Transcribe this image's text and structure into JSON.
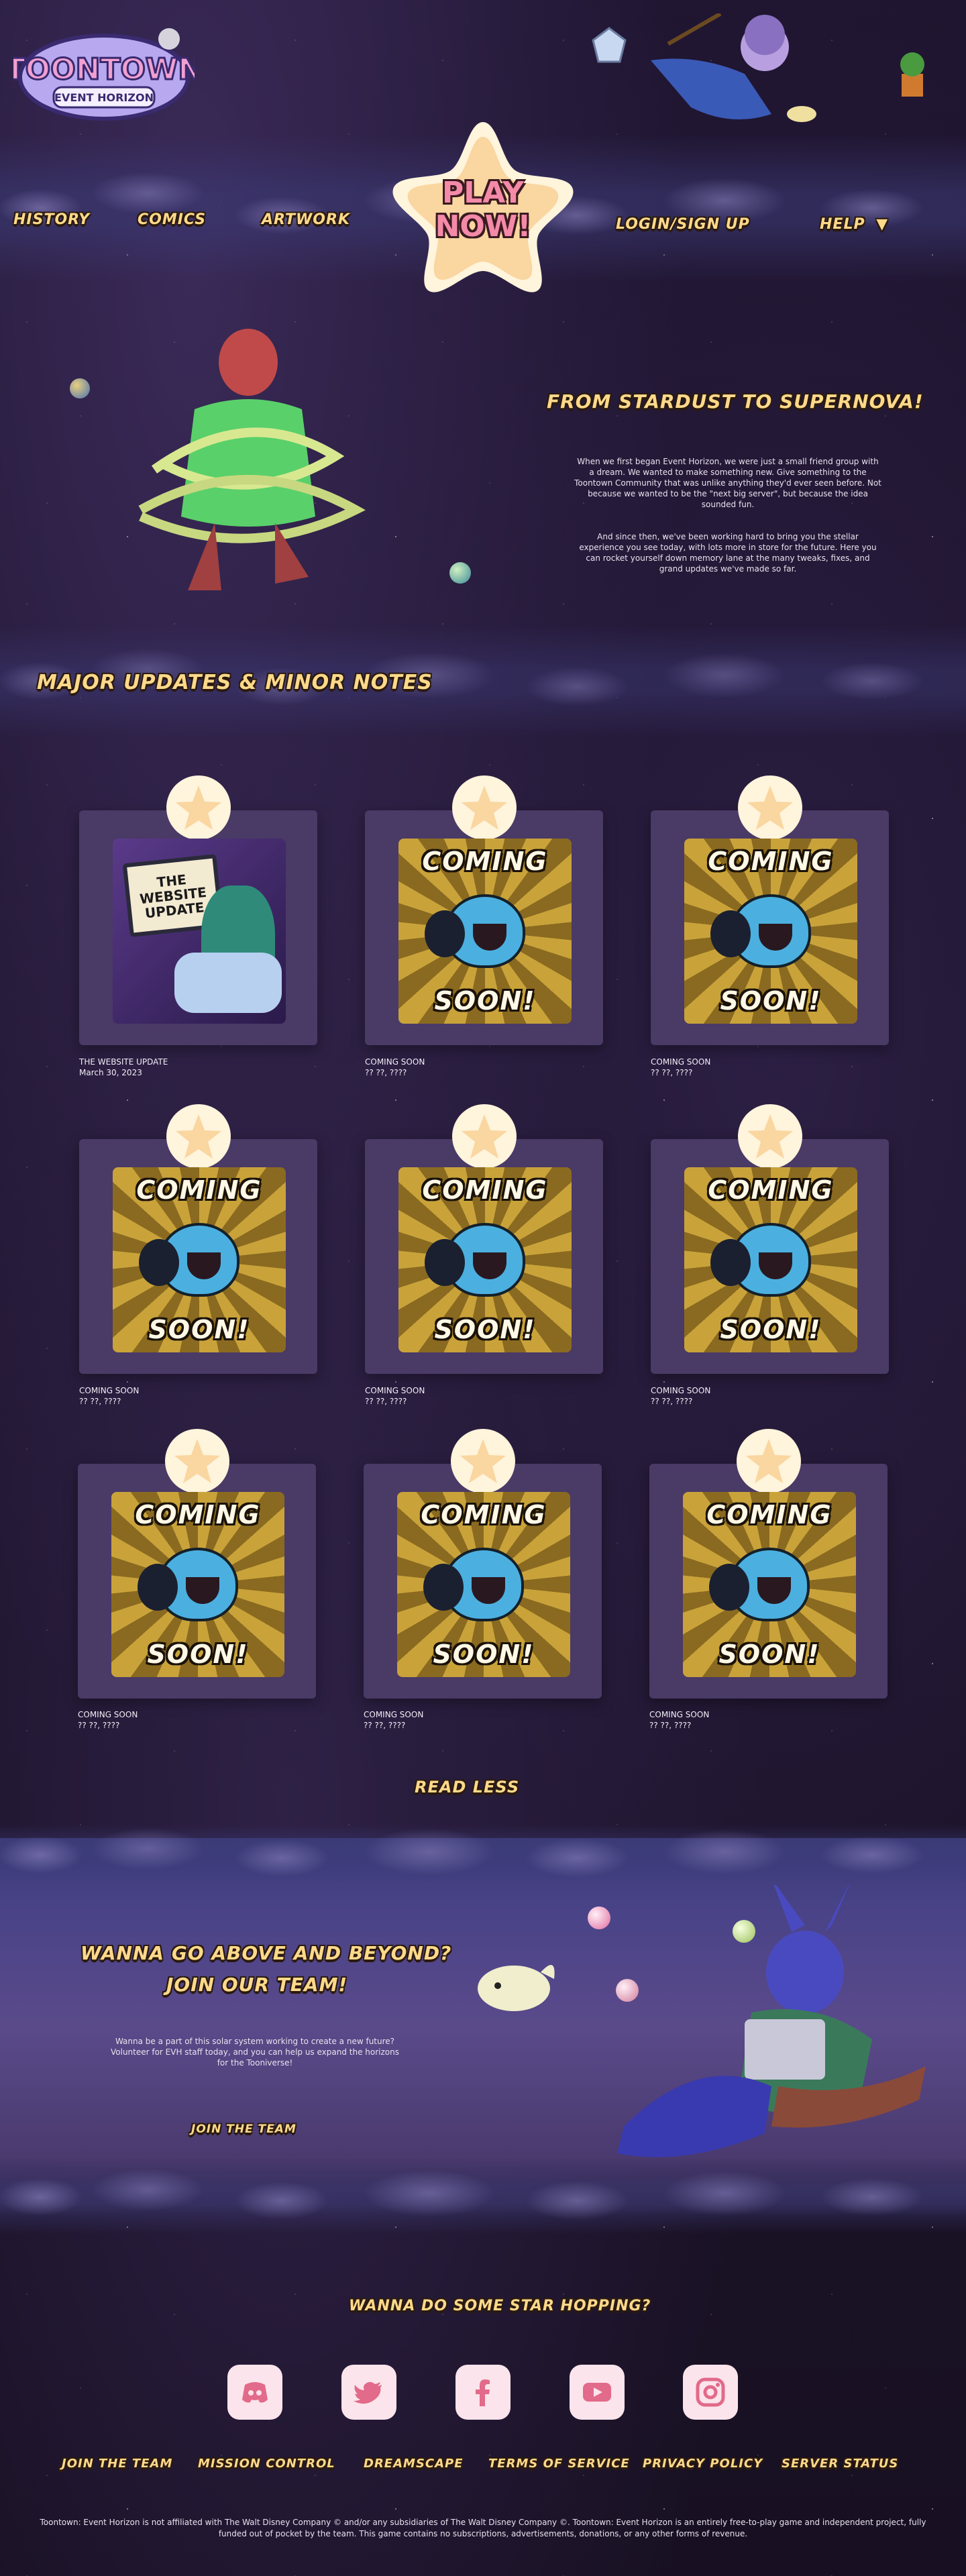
{
  "header": {
    "logo_main": "TOONTOWN",
    "logo_sub": "EVENT HORIZON",
    "nav": {
      "history": "History",
      "comics": "Comics",
      "artwork": "Artwork",
      "play_line1": "PLAY",
      "play_line2": "NOW!",
      "login": "Login/Sign Up",
      "help": "Help"
    }
  },
  "intro": {
    "title": "From Stardust to Supernova!",
    "para1": "When we first began Event Horizon, we were just a small friend group with a dream. We wanted to make something new. Give something to the Toontown Community that was unlike anything they'd ever seen before. Not because we wanted to be the \"next big server\", but because the idea sounded fun.",
    "para2": "And since then, we've been working hard to bring you the stellar experience you see today, with lots more in store for the future. Here you can rocket yourself down memory lane at the many tweaks, fixes, and grand updates we've made so far."
  },
  "updates": {
    "title": "Major Updates & Minor Notes",
    "website_thumb_text": "THE WEBSITE UPDATE",
    "coming_top": "COMING",
    "coming_bottom": "SOON!",
    "cards": [
      {
        "title": "THE WEBSITE UPDATE",
        "date": "March 30, 2023"
      },
      {
        "title": "COMING SOON",
        "date": "?? ??, ????"
      },
      {
        "title": "COMING SOON",
        "date": "?? ??, ????"
      },
      {
        "title": "COMING SOON",
        "date": "?? ??, ????"
      },
      {
        "title": "COMING SOON",
        "date": "?? ??, ????"
      },
      {
        "title": "COMING SOON",
        "date": "?? ??, ????"
      },
      {
        "title": "COMING SOON",
        "date": "?? ??, ????"
      },
      {
        "title": "COMING SOON",
        "date": "?? ??, ????"
      },
      {
        "title": "COMING SOON",
        "date": "?? ??, ????"
      }
    ],
    "read_less": "Read Less"
  },
  "team": {
    "title_line1": "Wanna go above and beyond?",
    "title_line2": "Join our team!",
    "body": "Wanna be a part of this solar system working to create a new future? Volunteer for EVH staff today, and you can help us expand the horizons for the Tooniverse!",
    "button": "Join the Team"
  },
  "footer": {
    "social_title": "Wanna do some star hopping?",
    "socials": [
      "discord-icon",
      "twitter-icon",
      "facebook-icon",
      "youtube-icon",
      "instagram-icon"
    ],
    "links": [
      "Join the Team",
      "Mission Control",
      "Dreamscape",
      "Terms of Service",
      "Privacy Policy",
      "Server Status"
    ],
    "legal": "Toontown: Event Horizon is not affiliated with The Walt Disney Company © and/or any subsidiaries of The Walt Disney Company ©. Toontown: Event Horizon is an entirely free-to-play game and independent project, fully funded out of pocket by the team. This game contains no subscriptions, advertisements, donations, or any other forms of revenue."
  },
  "colors": {
    "accent_yellow": "#ffd98a",
    "cream": "#fff4dc",
    "card_bg": "#4a3a66",
    "social_bg": "#fbe4ec"
  }
}
